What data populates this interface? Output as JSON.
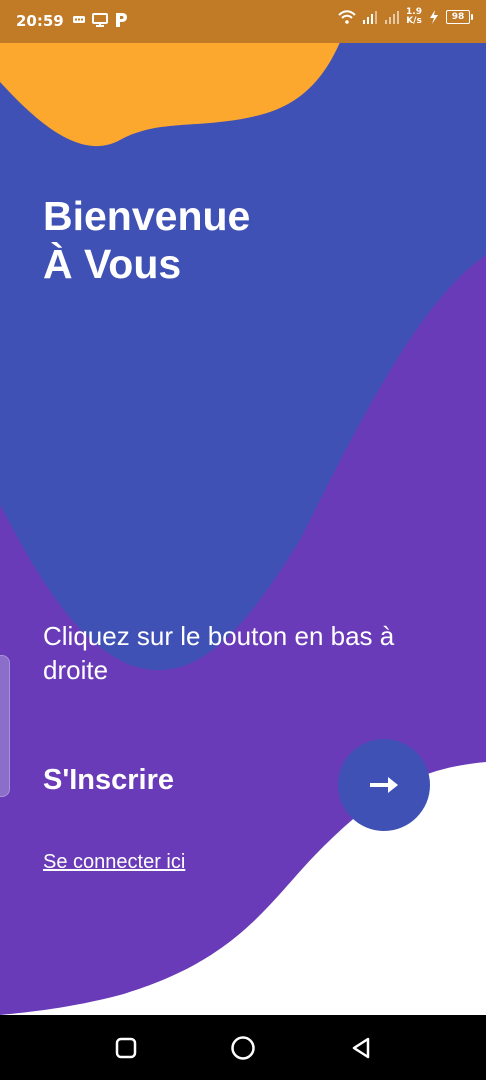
{
  "status_bar": {
    "time": "20:59",
    "net_speed_value": "1.9",
    "net_speed_unit": "K/s",
    "battery": "98",
    "left_icons": [
      "message-icon",
      "cast-icon",
      "p-icon"
    ],
    "right_icons": [
      "wifi-icon",
      "signal-icon",
      "signal-icon",
      "charging-icon"
    ]
  },
  "welcome": {
    "line1": "Bienvenue",
    "line2": "À Vous"
  },
  "hint": "Cliquez sur le bouton en bas à droite",
  "signup": {
    "label": "S'Inscrire",
    "button_icon": "arrow-right-icon"
  },
  "login_link": "Se connecter ici",
  "nav": {
    "icons": [
      "square-icon",
      "circle-icon",
      "back-triangle-icon"
    ]
  },
  "colors": {
    "purple": "#6a3bb8",
    "indigo": "#3f51b5",
    "orange": "#fca72e",
    "status_bar": "#c17a26",
    "white": "#ffffff"
  }
}
